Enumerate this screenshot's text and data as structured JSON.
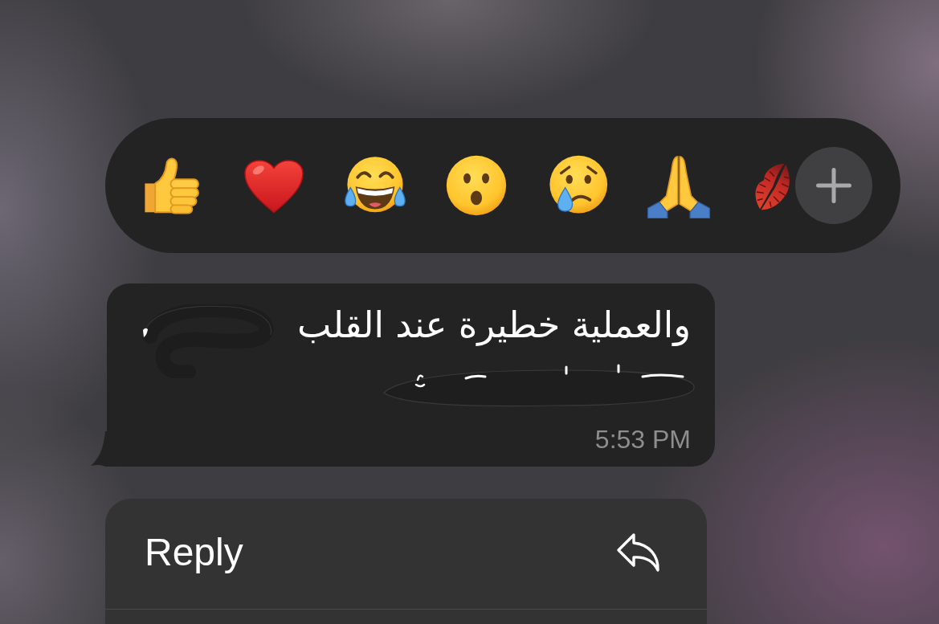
{
  "reaction_bar": {
    "reactions": [
      {
        "kind": "thumbs_up"
      },
      {
        "kind": "heart"
      },
      {
        "kind": "tears_of_joy"
      },
      {
        "kind": "surprised"
      },
      {
        "kind": "crying"
      },
      {
        "kind": "praying_hands"
      },
      {
        "kind": "kiss_mark"
      }
    ]
  },
  "message": {
    "text": "والعملية خطيرة عند القلب",
    "redacted": true,
    "time": "5:53 PM"
  },
  "menu": {
    "items": [
      {
        "label": "Reply"
      }
    ]
  }
}
